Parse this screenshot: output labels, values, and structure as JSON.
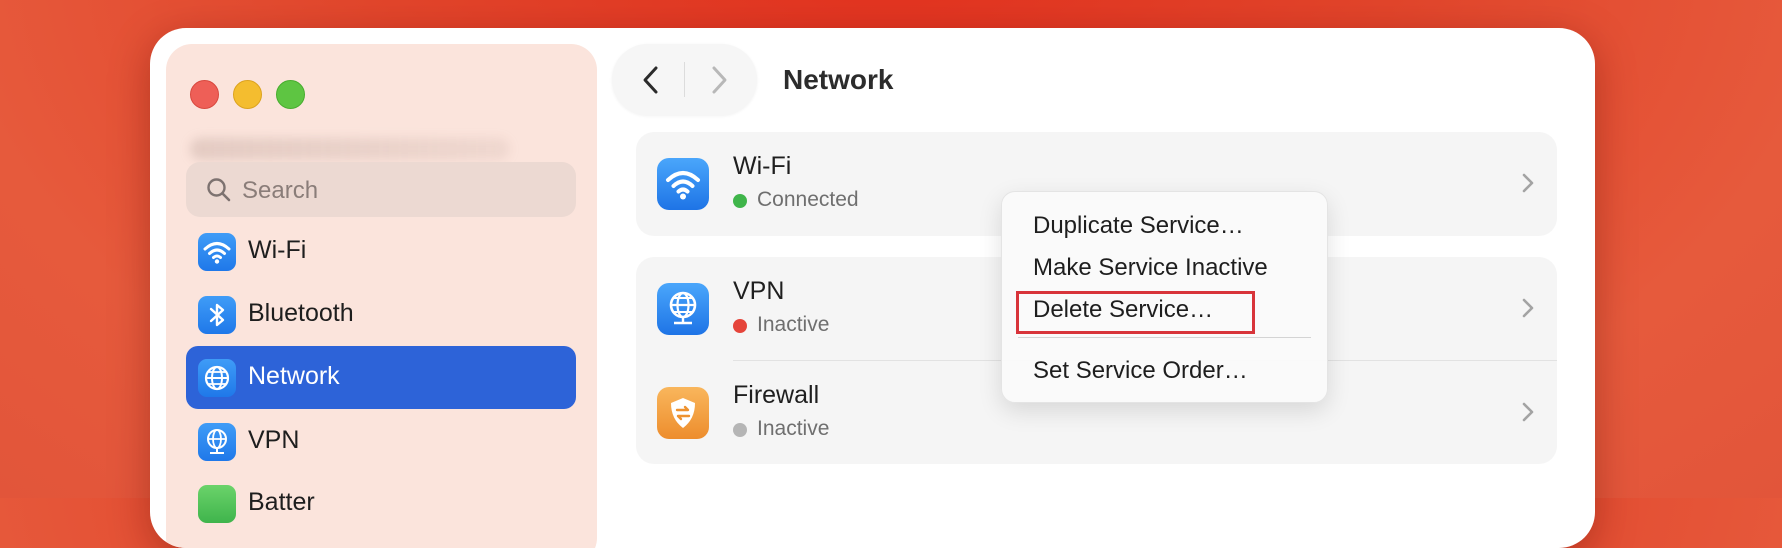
{
  "window": {
    "page_title": "Network"
  },
  "sidebar": {
    "search_placeholder": "Search",
    "items": [
      {
        "label": "Wi-Fi",
        "icon": "wifi-icon",
        "active": false
      },
      {
        "label": "Bluetooth",
        "icon": "bluetooth-icon",
        "active": false
      },
      {
        "label": "Network",
        "icon": "globe-icon",
        "active": true
      },
      {
        "label": "VPN",
        "icon": "vpn-globe-icon",
        "active": false
      },
      {
        "label": "Batter",
        "icon": "battery-icon",
        "active": false
      }
    ]
  },
  "services": [
    {
      "name": "Wi-Fi",
      "status": "Connected",
      "status_color": "#3fb54a",
      "icon": "wifi-icon"
    },
    {
      "name": "VPN",
      "status": "Inactive",
      "status_color": "#e5443a",
      "icon": "vpn-globe-icon"
    },
    {
      "name": "Firewall",
      "status": "Inactive",
      "status_color": "#b5b5b5",
      "icon": "firewall-icon"
    }
  ],
  "context_menu": {
    "items": [
      "Duplicate Service…",
      "Make Service Inactive",
      "Delete Service…",
      "Set Service Order…"
    ],
    "highlighted": "Delete Service…",
    "highlight_color": "#d8343a"
  },
  "colors": {
    "accent": "#2d63d8",
    "background": "#e3401f"
  }
}
